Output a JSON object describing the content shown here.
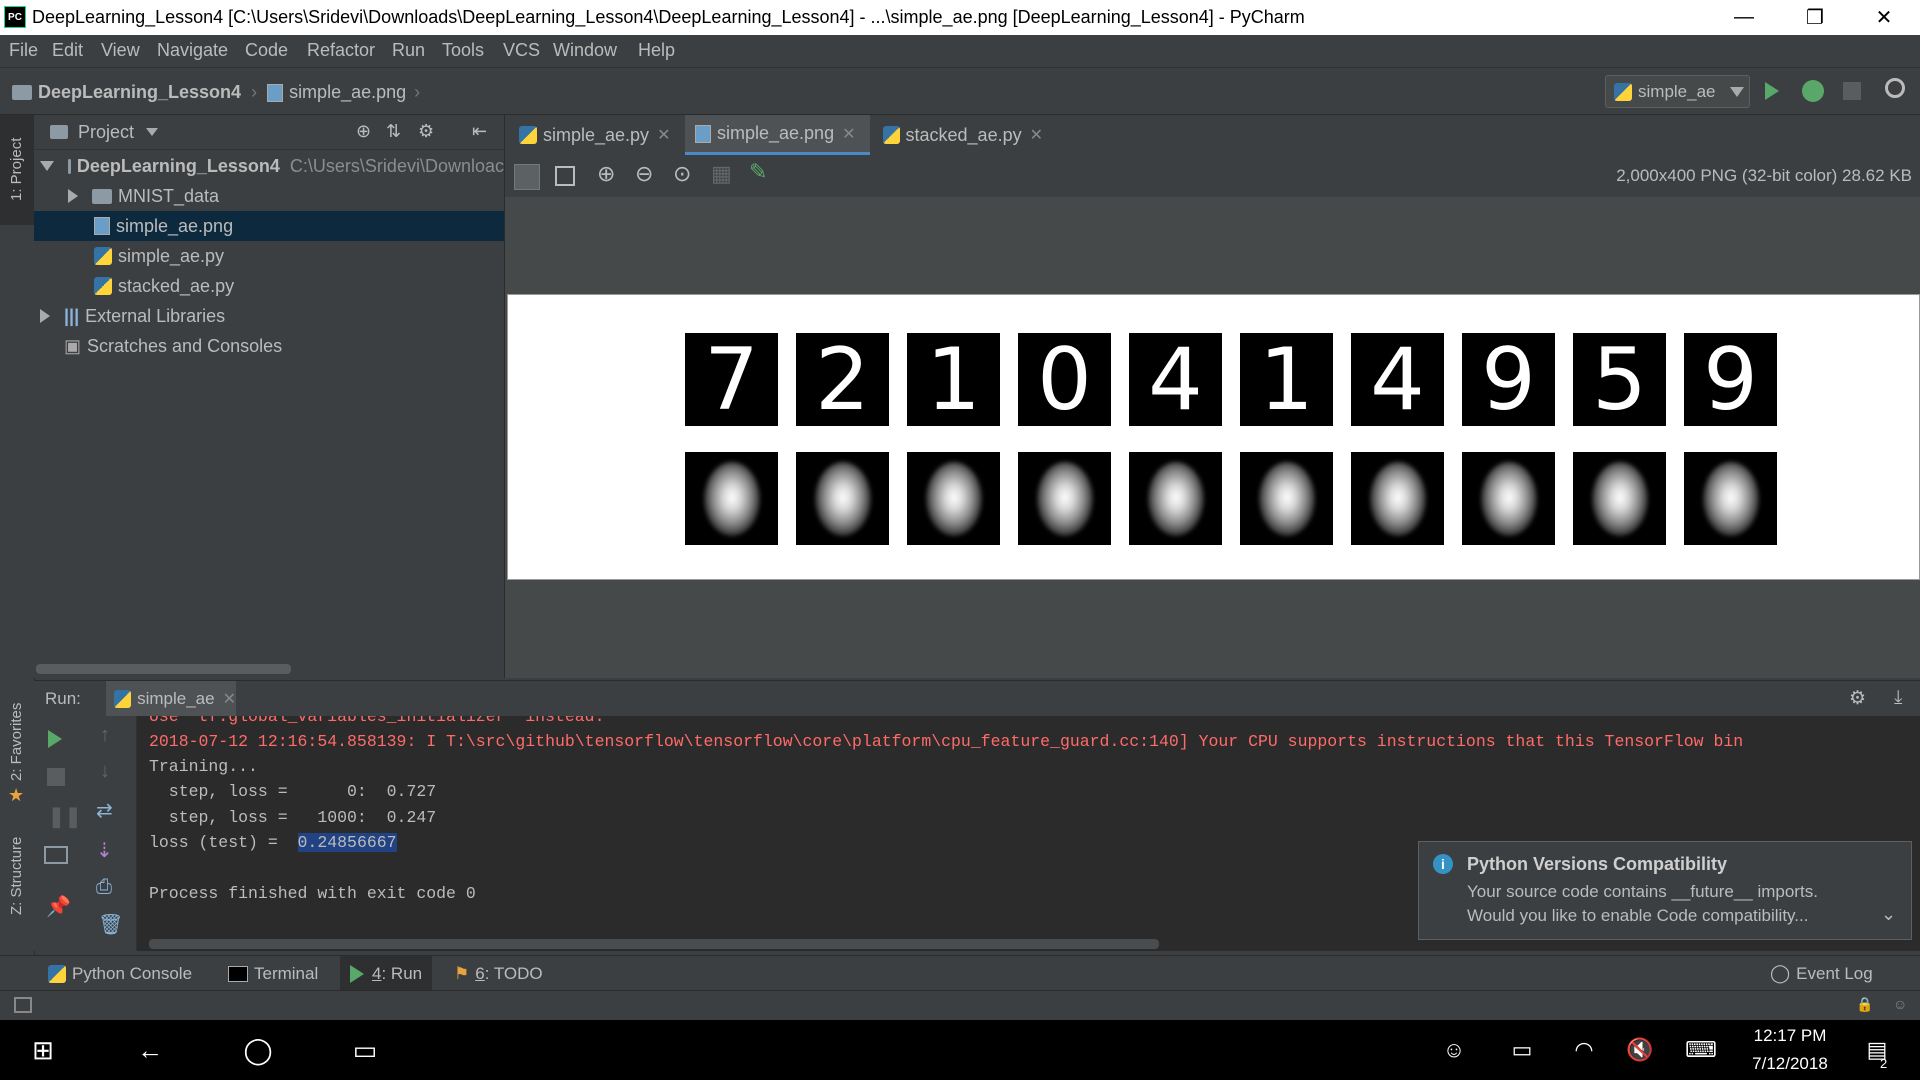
{
  "window": {
    "title": "DeepLearning_Lesson4 [C:\\Users\\Sridevi\\Downloads\\DeepLearning_Lesson4\\DeepLearning_Lesson4] - ...\\simple_ae.png [DeepLearning_Lesson4] - PyCharm",
    "logo": "PC",
    "minimize": "—",
    "restore": "❐",
    "close": "✕"
  },
  "menu": [
    "File",
    "Edit",
    "View",
    "Navigate",
    "Code",
    "Refactor",
    "Run",
    "Tools",
    "VCS",
    "Window",
    "Help"
  ],
  "breadcrumb": {
    "project": "DeepLearning_Lesson4",
    "file": "simple_ae.png"
  },
  "run_config": {
    "name": "simple_ae"
  },
  "left_stripe": {
    "project": "1: Project",
    "favorites": "2: Favorites",
    "structure": "Z: Structure"
  },
  "project_panel": {
    "title": "Project",
    "root": {
      "name": "DeepLearning_Lesson4",
      "path": "C:\\Users\\Sridevi\\Downloac"
    },
    "items": [
      {
        "name": "MNIST_data",
        "type": "folder"
      },
      {
        "name": "simple_ae.png",
        "type": "image",
        "selected": true
      },
      {
        "name": "simple_ae.py",
        "type": "python"
      },
      {
        "name": "stacked_ae.py",
        "type": "python"
      }
    ],
    "external_libraries": "External Libraries",
    "scratches": "Scratches and Consoles"
  },
  "editor_tabs": [
    {
      "label": "simple_ae.py",
      "active": false
    },
    {
      "label": "simple_ae.png",
      "active": true
    },
    {
      "label": "stacked_ae.py",
      "active": false
    }
  ],
  "image_info": "2,000x400 PNG (32-bit color) 28.62 KB",
  "image_digits": [
    "7",
    "2",
    "1",
    "0",
    "4",
    "1",
    "4",
    "9",
    "5",
    "9"
  ],
  "run_panel": {
    "label": "Run:",
    "tab": "simple_ae",
    "console": {
      "line0": "Use `tf.global_variables_initializer` instead.",
      "line1": "2018-07-12 12:16:54.858139: I T:\\src\\github\\tensorflow\\tensorflow\\core\\platform\\cpu_feature_guard.cc:140] Your CPU supports instructions that this TensorFlow bin",
      "line2": "Training...",
      "line3": "  step, loss =      0:  0.727",
      "line4": "  step, loss =   1000:  0.247",
      "line5_prefix": "loss (test) =  ",
      "line5_value": "0.24856667",
      "line6": "Process finished with exit code 0"
    }
  },
  "notification": {
    "title": "Python Versions Compatibility",
    "line1": "Your source code contains __future__ imports.",
    "line2": "Would you like to enable Code compatibility..."
  },
  "tool_tabs": {
    "python_console": "Python Console",
    "terminal": "Terminal",
    "run_num": "4",
    "run": ": Run",
    "todo_num": "6",
    "todo": ": TODO",
    "event_log": "Event Log"
  },
  "taskbar": {
    "time": "12:17 PM",
    "date": "7/12/2018",
    "notifications": "2"
  }
}
